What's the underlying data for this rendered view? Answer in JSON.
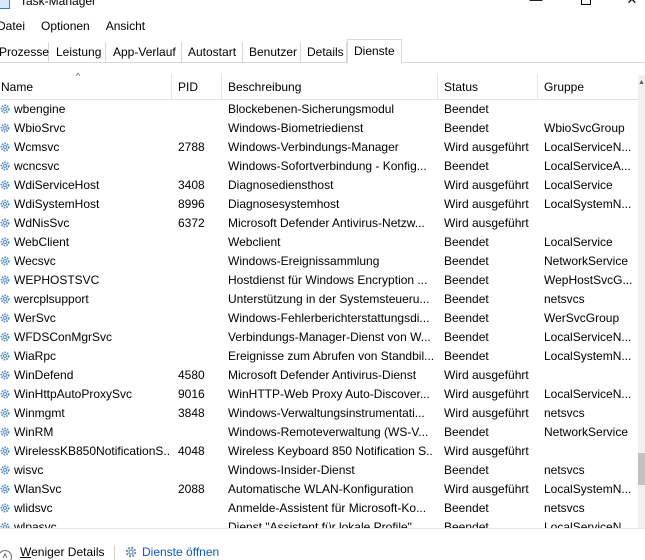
{
  "window": {
    "title": "Task-Manager",
    "minimize_glyph": "—",
    "close_glyph": "✕"
  },
  "menu": [
    "Datei",
    "Optionen",
    "Ansicht"
  ],
  "tabs": [
    {
      "label": "Prozesse",
      "active": false
    },
    {
      "label": "Leistung",
      "active": false
    },
    {
      "label": "App-Verlauf",
      "active": false
    },
    {
      "label": "Autostart",
      "active": false
    },
    {
      "label": "Benutzer",
      "active": false
    },
    {
      "label": "Details",
      "active": false
    },
    {
      "label": "Dienste",
      "active": true
    }
  ],
  "columns": {
    "name": "Name",
    "pid": "PID",
    "description": "Beschreibung",
    "status": "Status",
    "group": "Gruppe",
    "sort_glyph": "^",
    "sorted_by": "name"
  },
  "services": [
    {
      "name": "wbengine",
      "pid": "",
      "description": "Blockebenen-Sicherungsmodul",
      "status": "Beendet",
      "group": ""
    },
    {
      "name": "WbioSrvc",
      "pid": "",
      "description": "Windows-Biometriedienst",
      "status": "Beendet",
      "group": "WbioSvcGroup"
    },
    {
      "name": "Wcmsvc",
      "pid": "2788",
      "description": "Windows-Verbindungs-Manager",
      "status": "Wird ausgeführt",
      "group": "LocalServiceN..."
    },
    {
      "name": "wcncsvc",
      "pid": "",
      "description": "Windows-Sofortverbindung - Konfig...",
      "status": "Beendet",
      "group": "LocalServiceA..."
    },
    {
      "name": "WdiServiceHost",
      "pid": "3408",
      "description": "Diagnosediensthost",
      "status": "Wird ausgeführt",
      "group": "LocalService"
    },
    {
      "name": "WdiSystemHost",
      "pid": "8996",
      "description": "Diagnosesystemhost",
      "status": "Wird ausgeführt",
      "group": "LocalSystemN..."
    },
    {
      "name": "WdNisSvc",
      "pid": "6372",
      "description": "Microsoft Defender Antivirus-Netzw...",
      "status": "Wird ausgeführt",
      "group": ""
    },
    {
      "name": "WebClient",
      "pid": "",
      "description": "Webclient",
      "status": "Beendet",
      "group": "LocalService"
    },
    {
      "name": "Wecsvc",
      "pid": "",
      "description": "Windows-Ereignissammlung",
      "status": "Beendet",
      "group": "NetworkService"
    },
    {
      "name": "WEPHOSTSVC",
      "pid": "",
      "description": "Hostdienst für Windows Encryption ...",
      "status": "Beendet",
      "group": "WepHostSvcG..."
    },
    {
      "name": "wercplsupport",
      "pid": "",
      "description": "Unterstützung in der Systemsteueru...",
      "status": "Beendet",
      "group": "netsvcs"
    },
    {
      "name": "WerSvc",
      "pid": "",
      "description": "Windows-Fehlerberichterstattungsdi...",
      "status": "Beendet",
      "group": "WerSvcGroup"
    },
    {
      "name": "WFDSConMgrSvc",
      "pid": "",
      "description": "Verbindungs-Manager-Dienst von W...",
      "status": "Beendet",
      "group": "LocalServiceN..."
    },
    {
      "name": "WiaRpc",
      "pid": "",
      "description": "Ereignisse zum Abrufen von Standbil...",
      "status": "Beendet",
      "group": "LocalSystemN..."
    },
    {
      "name": "WinDefend",
      "pid": "4580",
      "description": "Microsoft Defender Antivirus-Dienst",
      "status": "Wird ausgeführt",
      "group": ""
    },
    {
      "name": "WinHttpAutoProxySvc",
      "pid": "9016",
      "description": "WinHTTP-Web Proxy Auto-Discover...",
      "status": "Wird ausgeführt",
      "group": "LocalServiceN..."
    },
    {
      "name": "Winmgmt",
      "pid": "3848",
      "description": "Windows-Verwaltungsinstrumentati...",
      "status": "Wird ausgeführt",
      "group": "netsvcs"
    },
    {
      "name": "WinRM",
      "pid": "",
      "description": "Windows-Remoteverwaltung (WS-V...",
      "status": "Beendet",
      "group": "NetworkService"
    },
    {
      "name": "WirelessKB850NotificationS...",
      "pid": "4048",
      "description": "Wireless Keyboard 850 Notification S...",
      "status": "Wird ausgeführt",
      "group": ""
    },
    {
      "name": "wisvc",
      "pid": "",
      "description": "Windows-Insider-Dienst",
      "status": "Beendet",
      "group": "netsvcs"
    },
    {
      "name": "WlanSvc",
      "pid": "2088",
      "description": "Automatische WLAN-Konfiguration",
      "status": "Wird ausgeführt",
      "group": "LocalSystemN..."
    },
    {
      "name": "wlidsvc",
      "pid": "",
      "description": "Anmelde-Assistent für Microsoft-Ko...",
      "status": "Beendet",
      "group": "netsvcs"
    },
    {
      "name": "wlpasvc",
      "pid": "",
      "description": "Dienst \"Assistent für lokale Profile\"",
      "status": "Beendet",
      "group": "LocalServiceN..."
    }
  ],
  "footer": {
    "fewer_details_label": "Weniger Details",
    "open_services_label": "Dienste öffnen"
  },
  "colors": {
    "link": "#0a59c9",
    "service_icon": "#5b8fc7",
    "tab_border": "#d9d9d9"
  }
}
